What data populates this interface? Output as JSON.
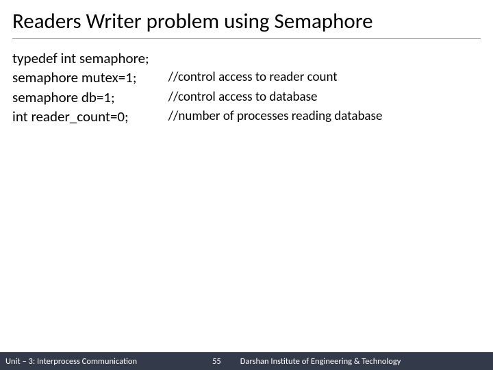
{
  "title": "Readers Writer problem using Semaphore",
  "code": {
    "l1": "typedef int semaphore;",
    "l2": "semaphore mutex=1;",
    "l3": "semaphore db=1;",
    "l4": "int reader_count=0;"
  },
  "comments": {
    "c2": "//control access to reader count",
    "c3": "//control access to database",
    "c4": "//number of processes reading database"
  },
  "footer": {
    "unit": "Unit – 3: Interprocess Communication",
    "page": "55",
    "org": "Darshan Institute of Engineering & Technology"
  }
}
